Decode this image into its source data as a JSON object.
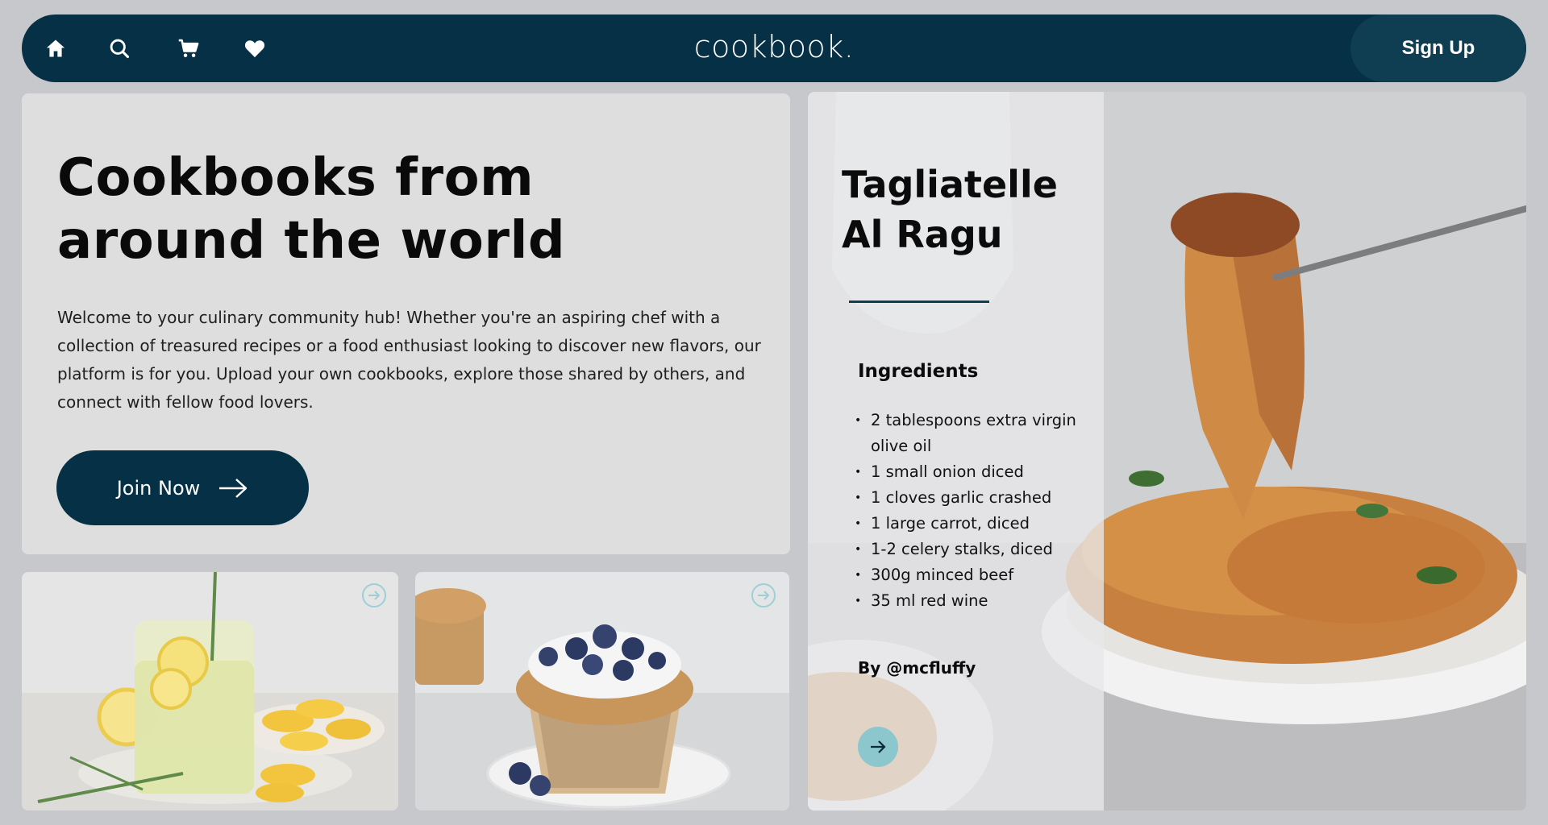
{
  "colors": {
    "nav_bg": "#063045",
    "page_bg": "#c7c8cb",
    "hero_bg": "#dedede",
    "accent_teal": "#8cc7cd"
  },
  "nav": {
    "icons": [
      "home-icon",
      "search-icon",
      "cart-icon",
      "heart-icon"
    ],
    "logo": "cookbook.",
    "signup_label": "Sign Up"
  },
  "hero": {
    "title": "Cookbooks from\naround the world",
    "body": "Welcome to your culinary community hub! Whether you're an aspiring chef with a collection of treasured recipes or a food enthusiast looking to discover new flavors, our platform is for you. Upload your own cookbooks, explore those shared by others, and connect with fellow food lovers.",
    "cta_label": "Join Now"
  },
  "cards": [
    {
      "subject": "lemonade with rosemary",
      "action_icon": "arrow-right-circle-icon"
    },
    {
      "subject": "blueberry muffin",
      "action_icon": "arrow-right-circle-icon"
    }
  ],
  "feature": {
    "title": "Tagliatelle\nAl Ragu",
    "ingredients_heading": "Ingredients",
    "ingredients": [
      "2 tablespoons extra virgin olive oil",
      "1 small onion diced",
      "1 cloves garlic crashed",
      "1 large carrot, diced",
      "1-2 celery stalks, diced",
      "300g minced beef",
      "35 ml red wine"
    ],
    "author": "By @mcfluffy"
  }
}
